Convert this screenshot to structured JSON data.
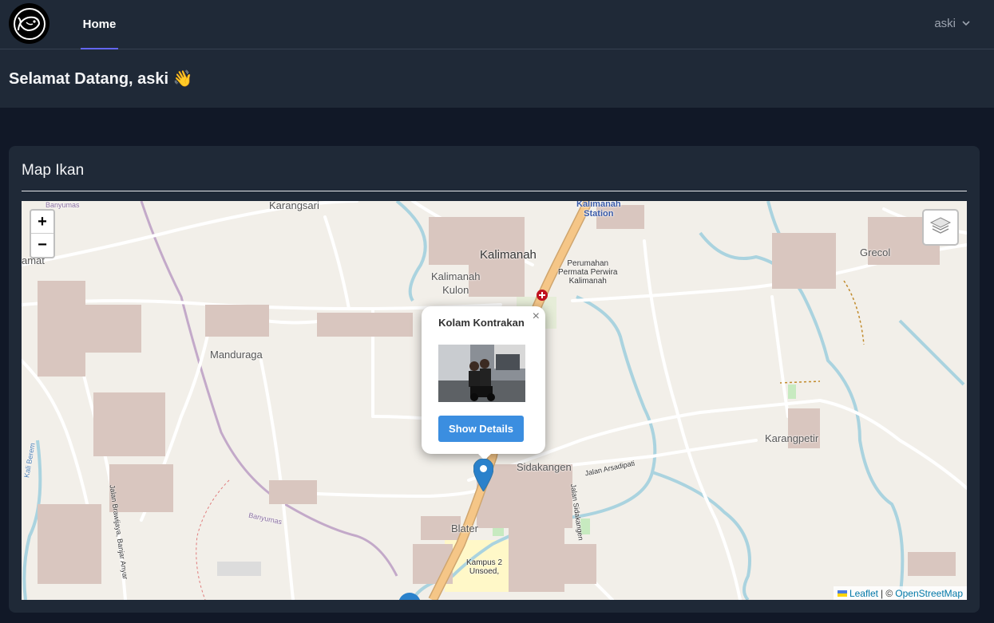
{
  "nav": {
    "home_label": "Home",
    "user_name": "aski"
  },
  "header": {
    "welcome": "Selamat Datang, aski 👋"
  },
  "card": {
    "title": "Map Ikan"
  },
  "map": {
    "zoom_in": "+",
    "zoom_out": "−",
    "places": {
      "karangsari": "Karangsari",
      "kalimanah": "Kalimanah",
      "kalimanah_kulon_1": "Kalimanah",
      "kalimanah_kulon_2": "Kulon",
      "perumahan_1": "Perumahan",
      "perumahan_2": "Permata Perwira",
      "perumahan_3": "Kalimanah",
      "station_1": "Kalimanah",
      "station_2": "Station",
      "grecol": "Grecol",
      "manduraga": "Manduraga",
      "karangpetir": "Karangpetir",
      "sidakangen": "Sidakangen",
      "blater": "Blater",
      "kampus_1": "Kampus 2",
      "kampus_2": "Unsoed,",
      "banyumas_1": "Banyumas",
      "banyumas_2": "Banyumas",
      "amat": "amat",
      "kali_berem": "Kali Berem",
      "jalan_brawijaya": "Jalan Brawijaya, Banjar Anyar",
      "jalan_arsadipati": "Jalan Arsadipati",
      "jalan_sidakangen": "Jalan Sidakangen"
    },
    "popup": {
      "title": "Kolam Kontrakan",
      "close": "×",
      "button": "Show Details"
    },
    "attribution": {
      "leaflet": "Leaflet",
      "separator": "| ©",
      "osm": "OpenStreetMap"
    }
  },
  "colors": {
    "accent": "#6366f1",
    "nav_bg": "#1f2937",
    "page_bg": "#111827",
    "map_bg": "#f2efe9",
    "main_road": "#f5c687",
    "river": "#aad3df",
    "popup_button": "#3b8ee0",
    "marker": "#2a81cb"
  }
}
